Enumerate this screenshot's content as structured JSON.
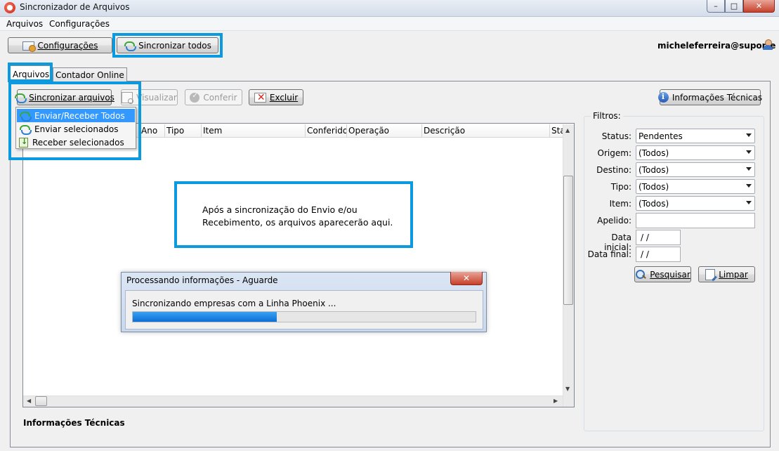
{
  "window": {
    "title": "Sincronizador de Arquivos",
    "controls": {
      "minimize": "–",
      "maximize": "□",
      "close": "✕"
    }
  },
  "menu": [
    "Arquivos",
    "Configurações"
  ],
  "toolbar": {
    "config_label": "Configurações",
    "sync_all_label": "Sincronizar todos"
  },
  "user": "micheleferreira@suporte",
  "tabs": [
    "Arquivos",
    "Contador Online"
  ],
  "actions": {
    "sync_files": "Sincronizar arquivos",
    "view": "Visualizar",
    "check": "Conferir",
    "delete": "Excluir",
    "tech_info": "Informações Técnicas"
  },
  "sync_menu": [
    {
      "label": "Enviar/Receber Todos",
      "icon": "sync-icon",
      "selected": true
    },
    {
      "label": "Enviar selecionados",
      "icon": "sync-icon"
    },
    {
      "label": "Receber selecionados",
      "icon": "receive-icon"
    }
  ],
  "grid": {
    "columns": [
      "Ano",
      "Tipo",
      "Item",
      "Conferido",
      "Operação",
      "Descrição",
      "Sta"
    ]
  },
  "annotation": "Após a sincronização do Envio e/ou Recebimento, os arquivos aparecerão aqui.",
  "progress_dialog": {
    "title": "Processando informações - Aguarde",
    "message": "Sincronizando empresas com a Linha Phoenix ...",
    "progress": 0.42
  },
  "filters": {
    "title": "Filtros:",
    "status": {
      "label": "Status:",
      "value": "Pendentes"
    },
    "origem": {
      "label": "Origem:",
      "value": "(Todos)"
    },
    "destino": {
      "label": "Destino:",
      "value": "(Todos)"
    },
    "tipo": {
      "label": "Tipo:",
      "value": "(Todos)"
    },
    "item": {
      "label": "Item:",
      "value": "(Todos)"
    },
    "apelido": {
      "label": "Apelido:",
      "value": ""
    },
    "data_inicial": {
      "label": "Data inicial:",
      "value": " /  /"
    },
    "data_final": {
      "label": "Data final:",
      "value": " /  /"
    },
    "search_label": "Pesquisar",
    "clear_label": "Limpar"
  },
  "info_bar_title": "Informações Técnicas",
  "colors": {
    "highlight": "#0b9ae0",
    "menu_selected": "#3399ff",
    "progress": "#0a6fd6"
  }
}
